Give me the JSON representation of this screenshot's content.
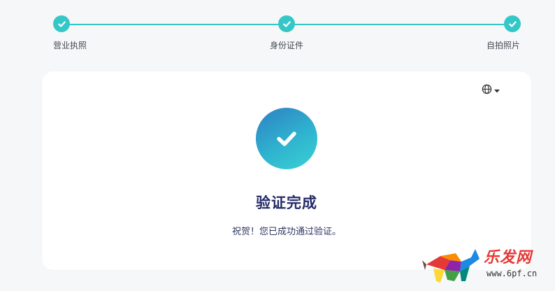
{
  "stepper": {
    "steps": [
      {
        "label": "营业执照",
        "status": "complete"
      },
      {
        "label": "身份证件",
        "status": "complete"
      },
      {
        "label": "自拍照片",
        "status": "complete"
      }
    ],
    "accent_color": "#35c7c7"
  },
  "card": {
    "language_icon": "globe-icon",
    "title": "验证完成",
    "message": "祝贺！您已成功通过验证。",
    "title_color": "#252a6b"
  },
  "watermark": {
    "logo_text": "乐发网",
    "url": "www.6pf.cn"
  }
}
